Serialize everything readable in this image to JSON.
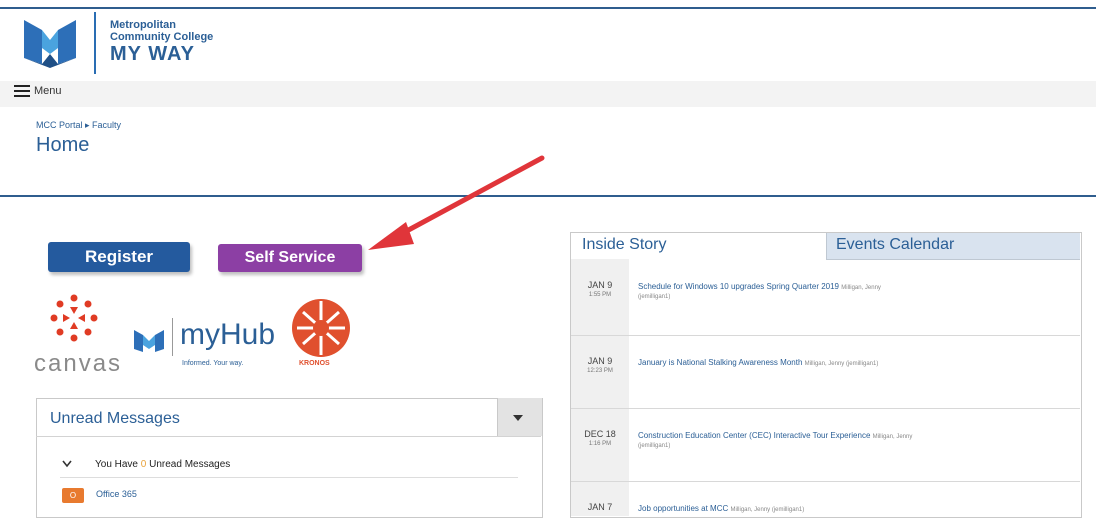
{
  "header": {
    "org_line1": "Metropolitan",
    "org_line2": "Community College",
    "portal_name": "MY WAY",
    "menu_label": "Menu"
  },
  "page": {
    "breadcrumb": "MCC Portal ▸ Faculty",
    "title": "Home"
  },
  "actions": {
    "register_label": "Register",
    "self_service_label": "Self Service"
  },
  "apps": {
    "canvas_label": "canvas",
    "myhub_label": "myHub",
    "myhub_tagline": "Informed. Your way.",
    "kronos_label": "KRONOS"
  },
  "messages": {
    "title": "Unread Messages",
    "prefix": "You Have ",
    "count": "0",
    "suffix": " Unread Messages",
    "office_badge": "O",
    "office_label": "Office 365"
  },
  "news": {
    "tabs": [
      "Inside Story",
      "Events Calendar"
    ],
    "items": [
      {
        "date": "JAN 9",
        "time": "1:55 PM",
        "title": "Schedule for Windows 10 upgrades Spring Quarter 2019",
        "author": "Milligan, Jenny",
        "author_id": "(jemilligan1)"
      },
      {
        "date": "JAN 9",
        "time": "12:23 PM",
        "title": "January is National Stalking Awareness Month",
        "author": "Milligan, Jenny (jemilligan1)",
        "author_id": ""
      },
      {
        "date": "DEC 18",
        "time": "1:16 PM",
        "title": "Construction Education Center (CEC) Interactive Tour Experience",
        "author": "Milligan, Jenny",
        "author_id": "(jemilligan1)"
      },
      {
        "date": "JAN 7",
        "time": "",
        "title": "Job opportunities at MCC",
        "author": "Milligan, Jenny (jemilligan1)",
        "author_id": ""
      }
    ]
  },
  "colors": {
    "brand_blue": "#2b5f96",
    "register_blue": "#245a9e",
    "self_service_purple": "#8c3fa4",
    "annotation_arrow": "#e0353a",
    "kronos_orange": "#e0502e"
  }
}
